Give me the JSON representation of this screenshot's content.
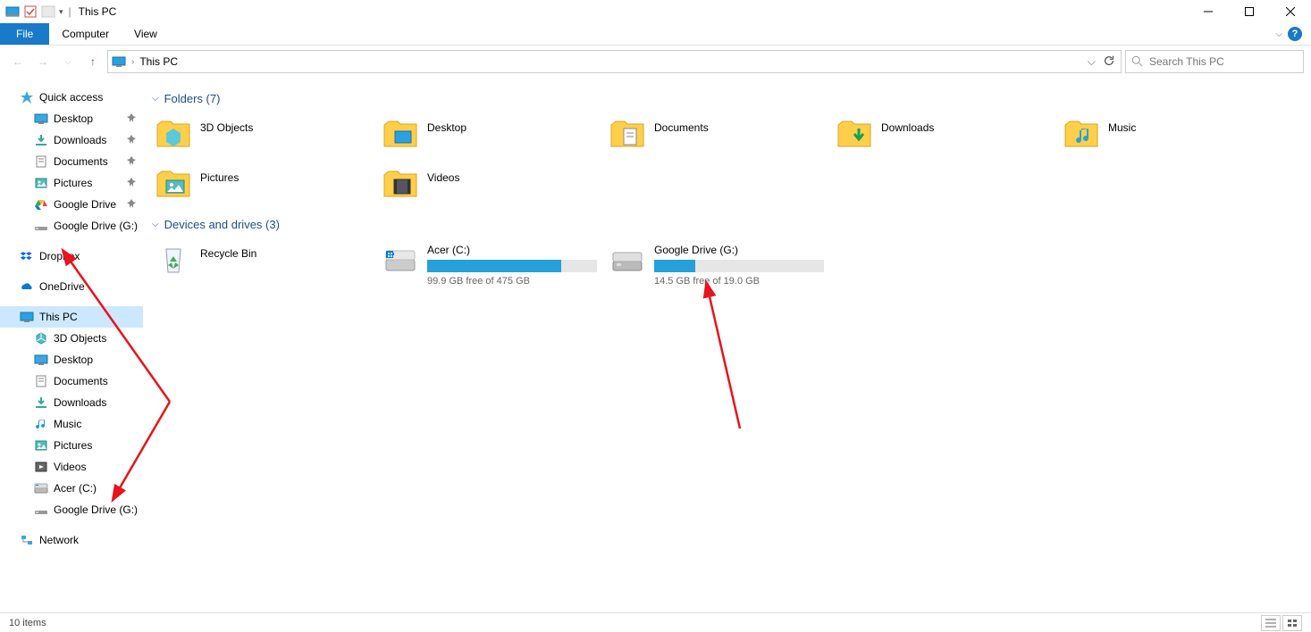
{
  "window": {
    "title": "This PC"
  },
  "ribbon": {
    "file": "File",
    "tabs": [
      "Computer",
      "View"
    ]
  },
  "nav": {
    "address": "This PC",
    "search_placeholder": "Search This PC"
  },
  "tree": {
    "quick_access": {
      "label": "Quick access",
      "items": [
        {
          "label": "Desktop",
          "pin": true,
          "icon": "desktop"
        },
        {
          "label": "Downloads",
          "pin": true,
          "icon": "downloads"
        },
        {
          "label": "Documents",
          "pin": true,
          "icon": "documents"
        },
        {
          "label": "Pictures",
          "pin": true,
          "icon": "pictures"
        },
        {
          "label": "Google Drive",
          "pin": true,
          "icon": "gdrive"
        },
        {
          "label": "Google Drive (G:)",
          "pin": true,
          "icon": "drive"
        }
      ]
    },
    "dropbox": "Dropbox",
    "onedrive": "OneDrive",
    "this_pc": {
      "label": "This PC",
      "items": [
        {
          "label": "3D Objects",
          "icon": "3d"
        },
        {
          "label": "Desktop",
          "icon": "desktop"
        },
        {
          "label": "Documents",
          "icon": "documents"
        },
        {
          "label": "Downloads",
          "icon": "downloads"
        },
        {
          "label": "Music",
          "icon": "music"
        },
        {
          "label": "Pictures",
          "icon": "pictures"
        },
        {
          "label": "Videos",
          "icon": "videos"
        },
        {
          "label": "Acer (C:)",
          "icon": "localdisk"
        },
        {
          "label": "Google Drive (G:)",
          "icon": "drive"
        }
      ]
    },
    "network": "Network"
  },
  "content": {
    "folders_header": "Folders (7)",
    "folders": [
      {
        "label": "3D Objects",
        "icon": "3d"
      },
      {
        "label": "Desktop",
        "icon": "desktop"
      },
      {
        "label": "Documents",
        "icon": "documents"
      },
      {
        "label": "Downloads",
        "icon": "downloads"
      },
      {
        "label": "Music",
        "icon": "music"
      },
      {
        "label": "Pictures",
        "icon": "pictures"
      },
      {
        "label": "Videos",
        "icon": "videos"
      }
    ],
    "drives_header": "Devices and drives (3)",
    "drives": [
      {
        "label": "Recycle Bin",
        "icon": "recycle",
        "type": "simple"
      },
      {
        "label": "Acer (C:)",
        "icon": "localdisk",
        "type": "bar",
        "free": "99.9 GB free of 475 GB",
        "fill_pct": 79
      },
      {
        "label": "Google Drive (G:)",
        "icon": "drive",
        "type": "bar",
        "free": "14.5 GB free of 19.0 GB",
        "fill_pct": 24
      }
    ]
  },
  "status": {
    "items": "10 items"
  }
}
